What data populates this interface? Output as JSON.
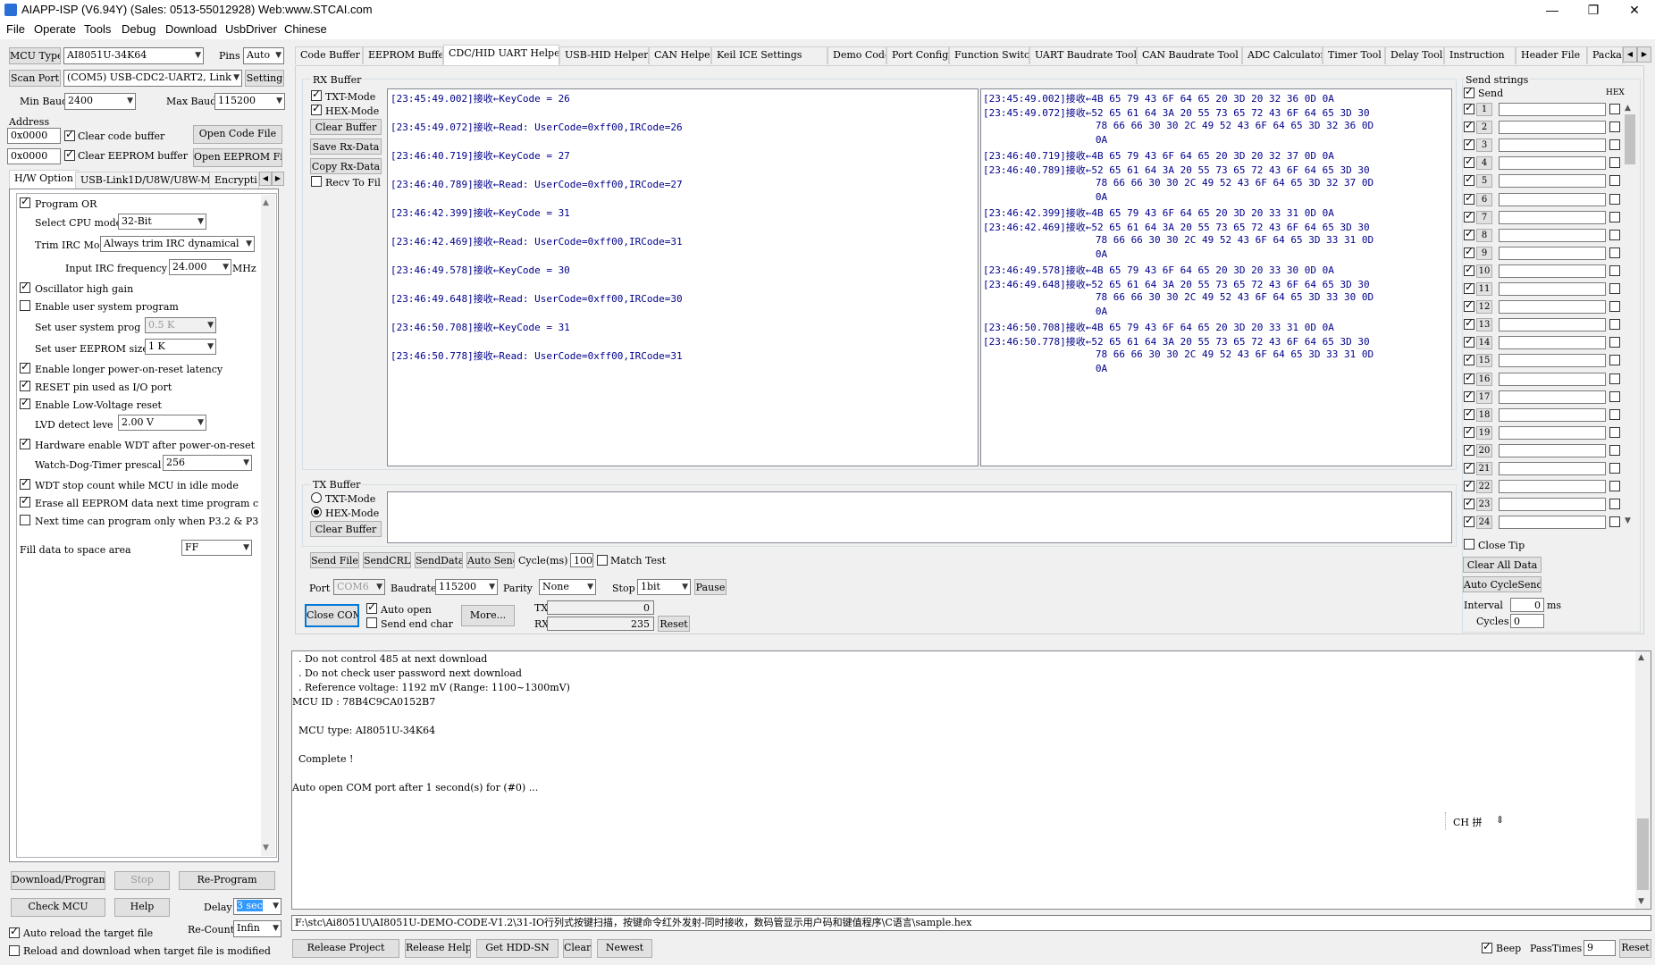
{
  "window": {
    "title": "AIAPP-ISP (V6.94Y) (Sales: 0513-55012928) Web:www.STCAI.com",
    "minimize": "—",
    "maximize": "❐",
    "close": "✕"
  },
  "menu": [
    "File",
    "Operate",
    "Tools",
    "Debug",
    "Download",
    "UsbDriver",
    "Chinese"
  ],
  "left": {
    "mcu_type_btn": "MCU Type",
    "mcu_type_value": "AI8051U-34K64",
    "pins_label": "Pins",
    "pins_value": "Auto",
    "scan_port_btn": "Scan Port",
    "port_value": "(COM5) USB-CDC2-UART2, Link",
    "setting_btn": "Setting",
    "min_baud_label": "Min Baud",
    "min_baud_value": "2400",
    "max_baud_label": "Max Baud",
    "max_baud_value": "115200",
    "address_label": "Address",
    "addr1": "0x0000",
    "clear_code": "Clear code buffer",
    "open_code_btn": "Open Code File",
    "addr2": "0x0000",
    "clear_eeprom": "Clear EEPROM buffer",
    "open_eeprom_btn": "Open EEPROM File",
    "tabs": [
      "H/W Option",
      "USB-Link1D/U8W/U8W-Mini",
      "Encrypti"
    ],
    "options": {
      "program_or": "Program OR",
      "cpu_mode_label": "Select CPU mode",
      "cpu_mode_value": "32-Bit",
      "trim_label": "Trim IRC Mo",
      "trim_value": "Always trim IRC dynamical",
      "irc_label": "Input IRC frequency",
      "irc_value": "24.000",
      "irc_unit": "MHz",
      "osc_gain": "Oscillator high gain",
      "user_sys": "Enable user system program",
      "user_sys_prog_label": "Set user system prog",
      "user_sys_prog_value": "0.5 K",
      "eeprom_size_label": "Set user EEPROM size",
      "eeprom_size_value": "1  K",
      "longer_por": "Enable longer power-on-reset latency",
      "reset_pin": "RESET pin used as I/O port",
      "lvr": "Enable Low-Voltage reset",
      "lvd_label": "LVD detect leve",
      "lvd_value": "2.00 V",
      "hw_wdt": "Hardware enable WDT after power-on-reset",
      "wdt_label": "Watch-Dog-Timer prescal",
      "wdt_value": "256",
      "wdt_idle": "WDT stop count while MCU in idle mode",
      "erase_eeprom": "Erase all EEPROM data next time program c",
      "next_time": "Next time can program only when P3.2 & P3",
      "fill_label": "Fill data to space area",
      "fill_value": "FF"
    },
    "download_btn": "Download/Program",
    "stop_btn": "Stop",
    "reprogram_btn": "Re-Program",
    "check_mcu_btn": "Check MCU",
    "help_btn": "Help",
    "delay_label": "Delay",
    "delay_value": "3 sec",
    "auto_reload": "Auto reload the target file",
    "recount_label": "Re-Count",
    "recount_value": "Infin",
    "reload_download": "Reload and download when target file is modified"
  },
  "tabs": [
    "Code Buffer",
    "EEPROM Buffer",
    "CDC/HID UART Helper",
    "USB-HID Helper",
    "CAN Helper",
    "Keil ICE Settings",
    "Demo Code",
    "Port Config",
    "Function Switch",
    "UART Baudrate Tool",
    "CAN Baudrate Tool",
    "ADC Calculator",
    "Timer Tool",
    "Delay Tool",
    "Instruction",
    "Header File",
    "Packa"
  ],
  "rx": {
    "title": "RX Buffer",
    "txt_mode": "TXT-Mode",
    "hex_mode": "HEX-Mode",
    "clear_btn": "Clear Buffer",
    "save_btn": "Save Rx-Data",
    "copy_btn": "Copy Rx-Data",
    "recv_file": "Recv To Fil",
    "text_lines": [
      "[23:45:49.002]接收←KeyCode = 26",
      "[23:45:49.072]接收←Read: UserCode=0xff00,IRCode=26",
      "[23:46:40.719]接收←KeyCode = 27",
      "[23:46:40.789]接收←Read: UserCode=0xff00,IRCode=27",
      "[23:46:42.399]接收←KeyCode = 31",
      "[23:46:42.469]接收←Read: UserCode=0xff00,IRCode=31",
      "[23:46:49.578]接收←KeyCode = 30",
      "[23:46:49.648]接收←Read: UserCode=0xff00,IRCode=30",
      "[23:46:50.708]接收←KeyCode = 31",
      "[23:46:50.778]接收←Read: UserCode=0xff00,IRCode=31"
    ],
    "hex_lines": [
      "[23:45:49.002]接收←4B 65 79 43 6F 64 65 20 3D 20 32 36 0D 0A",
      "[23:45:49.072]接收←52 65 61 64 3A 20 55 73 65 72 43 6F 64 65 3D 30",
      "                   78 66 66 30 30 2C 49 52 43 6F 64 65 3D 32 36 0D",
      "                   0A",
      "[23:46:40.719]接收←4B 65 79 43 6F 64 65 20 3D 20 32 37 0D 0A",
      "[23:46:40.789]接收←52 65 61 64 3A 20 55 73 65 72 43 6F 64 65 3D 30",
      "                   78 66 66 30 30 2C 49 52 43 6F 64 65 3D 32 37 0D",
      "                   0A",
      "[23:46:42.399]接收←4B 65 79 43 6F 64 65 20 3D 20 33 31 0D 0A",
      "[23:46:42.469]接收←52 65 61 64 3A 20 55 73 65 72 43 6F 64 65 3D 30",
      "                   78 66 66 30 30 2C 49 52 43 6F 64 65 3D 33 31 0D",
      "                   0A",
      "[23:46:49.578]接收←4B 65 79 43 6F 64 65 20 3D 20 33 30 0D 0A",
      "[23:46:49.648]接收←52 65 61 64 3A 20 55 73 65 72 43 6F 64 65 3D 30",
      "                   78 66 66 30 30 2C 49 52 43 6F 64 65 3D 33 30 0D",
      "                   0A",
      "[23:46:50.708]接收←4B 65 79 43 6F 64 65 20 3D 20 33 31 0D 0A",
      "[23:46:50.778]接收←52 65 61 64 3A 20 55 73 65 72 43 6F 64 65 3D 30",
      "                   78 66 66 30 30 2C 49 52 43 6F 64 65 3D 33 31 0D",
      "                   0A"
    ]
  },
  "tx": {
    "title": "TX Buffer",
    "txt_mode": "TXT-Mode",
    "hex_mode": "HEX-Mode",
    "clear_btn": "Clear Buffer",
    "send_file_btn": "Send File",
    "send_crlf_btn": "SendCRLF",
    "send_data_btn": "SendData",
    "auto_send_btn": "Auto Senc",
    "cycle_label": "Cycle(ms)",
    "cycle_value": "100",
    "match_test": "Match Test"
  },
  "port": {
    "port_label": "Port",
    "port_value": "COM6",
    "baud_label": "Baudrate",
    "baud_value": "115200",
    "parity_label": "Parity",
    "parity_value": "None",
    "stop_label": "Stop",
    "stop_value": "1bit",
    "pause_btn": "Pause",
    "close_btn": "Close COM",
    "auto_open": "Auto open",
    "send_end": "Send end char",
    "more_btn": "More...",
    "tx_label": "TX",
    "tx_value": "0",
    "rx_label": "RX",
    "rx_value": "235",
    "reset_btn": "Reset"
  },
  "send_strings": {
    "title": "Send strings",
    "send_label": "Send",
    "hex_label": "HEX",
    "numbers": [
      "1",
      "2",
      "3",
      "4",
      "5",
      "6",
      "7",
      "8",
      "9",
      "10",
      "11",
      "12",
      "13",
      "14",
      "15",
      "16",
      "17",
      "18",
      "19",
      "20",
      "21",
      "22",
      "23",
      "24"
    ],
    "close_tip": "Close Tip",
    "clear_all_btn": "Clear All Data",
    "auto_cycle_btn": "Auto CycleSend",
    "interval_label": "Interval",
    "interval_value": "0",
    "interval_unit": "ms",
    "cycles_label": "Cycles",
    "cycles_value": "0"
  },
  "log": {
    "lines": [
      "  . Do not control 485 at next download",
      "  . Do not check user password next download",
      "  . Reference voltage: 1192 mV (Range: 1100~1300mV)",
      "MCU ID : 78B4C9CA0152B7",
      "",
      "  MCU type: AI8051U-34K64",
      "",
      "  Complete !",
      "",
      "Auto open COM port after 1 second(s) for (#0) ..."
    ],
    "ime": "CH 拼"
  },
  "path": "F:\\stc\\Ai8051U\\AI8051U-DEMO-CODE-V1.2\\31-IO行列式按键扫描，按键命令红外发射-同时接收，数码管显示用户码和键值程序\\C语言\\sample.hex",
  "bottom": {
    "release_project_btn": "Release Project",
    "release_help_btn": "Release Help",
    "get_hdd_btn": "Get HDD-SN",
    "clear_btn": "Clear",
    "newest_btn": "Newest",
    "beep": "Beep",
    "passtimes_label": "PassTimes",
    "passtimes_value": "9",
    "reset_btn": "Reset"
  }
}
